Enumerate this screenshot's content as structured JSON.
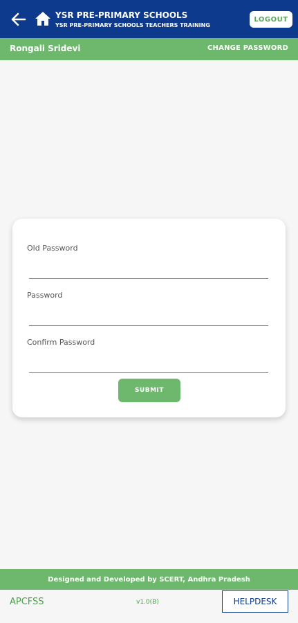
{
  "header": {
    "title": "YSR PRE-PRIMARY SCHOOLS",
    "subtitle": "YSR PRE-PRIMARY SCHOOLS TEACHERS TRAINING",
    "logout_label": "LOGOUT",
    "back_icon": "arrow-left-icon",
    "home_icon": "home-icon"
  },
  "userbar": {
    "user_name": "Rongali Sridevi",
    "page_heading": "CHANGE PASSWORD"
  },
  "form": {
    "old_password_label": "Old Password",
    "old_password_value": "",
    "password_label": "Password",
    "password_value": "",
    "confirm_password_label": "Confirm Password",
    "confirm_password_value": "",
    "submit_label": "SUBMIT"
  },
  "footer": {
    "credit": "Designed and Developed by SCERT, Andhra Pradesh",
    "org": "APCFSS",
    "version": "v1.0(B)",
    "helpdesk_label": "HELPDESK"
  },
  "colors": {
    "header_bg": "#0d3a8c",
    "accent_green": "#6db86d",
    "page_bg": "#f6f6f6"
  }
}
